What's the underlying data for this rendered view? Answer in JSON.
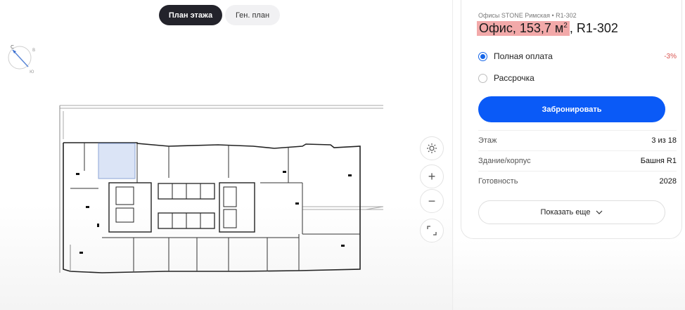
{
  "tabs": {
    "floor_plan": "План этажа",
    "site_plan": "Ген. план"
  },
  "compass": {
    "letter_top": "С",
    "letter_bottom": "Ю",
    "letter_right": "В",
    "icon": "compass-icon"
  },
  "map_controls": {
    "sun": "sun-icon",
    "zoom_in": "+",
    "zoom_out": "−",
    "fullscreen": "expand-icon"
  },
  "card": {
    "breadcrumb": "Офисы STONE Римская • R1-302",
    "title_highlight": "Офис, 153,7 м",
    "title_sup": "2",
    "title_rest": ", R1-302",
    "payment": [
      {
        "label": "Полная оплата",
        "badge": "-3%",
        "selected": true
      },
      {
        "label": "Рассрочка",
        "badge": "",
        "selected": false
      }
    ],
    "book_label": "Забронировать",
    "properties": [
      {
        "label": "Этаж",
        "value": "3 из 18"
      },
      {
        "label": "Здание/корпус",
        "value": "Башня R1"
      },
      {
        "label": "Готовность",
        "value": "2028"
      }
    ],
    "more_label": "Показать еще"
  },
  "colors": {
    "accent": "#0a5af7",
    "tab_active_bg": "#23232b",
    "highlight": "#f2a9a9",
    "selected_unit": "#dbe4f6",
    "discount": "#d9534f"
  }
}
